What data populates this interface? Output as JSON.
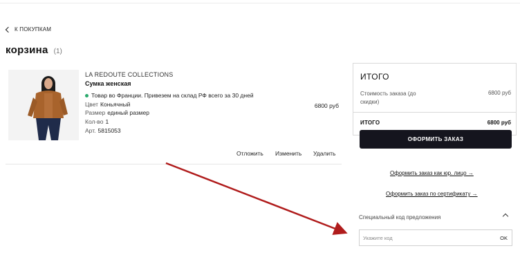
{
  "nav": {
    "back_label": "К ПОКУПКАМ"
  },
  "cart": {
    "title": "корзина",
    "count": "(1)"
  },
  "item": {
    "brand": "LA REDOUTE COLLECTIONS",
    "name": "Сумка женская",
    "shipping_note": "Товар во Франции. Привезем на склад РФ всего за 30 дней",
    "color_label": "Цвет",
    "color_value": "Коньячный",
    "size_label": "Размер",
    "size_value": "единый размер",
    "qty_label": "Кол-во",
    "qty_value": "1",
    "sku_label": "Арт.",
    "sku_value": "5815053",
    "price": "6800 руб",
    "actions": {
      "postpone": "Отложить",
      "edit": "Изменить",
      "delete": "Удалить"
    }
  },
  "summary": {
    "title": "ИТОГО",
    "cost_label": "Стоимость заказа (до скидки)",
    "cost_value": "6800 руб",
    "total_label": "ИТОГО",
    "total_value": "6800 руб",
    "checkout_button": "ОФОРМИТЬ ЗАКАЗ"
  },
  "links": {
    "legal": "Оформить заказ как юр. лицо →",
    "certificate": "Оформить заказ по сертификату →"
  },
  "promo": {
    "label": "Специальный код предложения",
    "placeholder": "Укажите код",
    "ok_label": "OK"
  },
  "colors": {
    "accent_dark": "#15151e",
    "stock_dot": "#2aa96c",
    "annotation_arrow": "#b01c1c"
  }
}
